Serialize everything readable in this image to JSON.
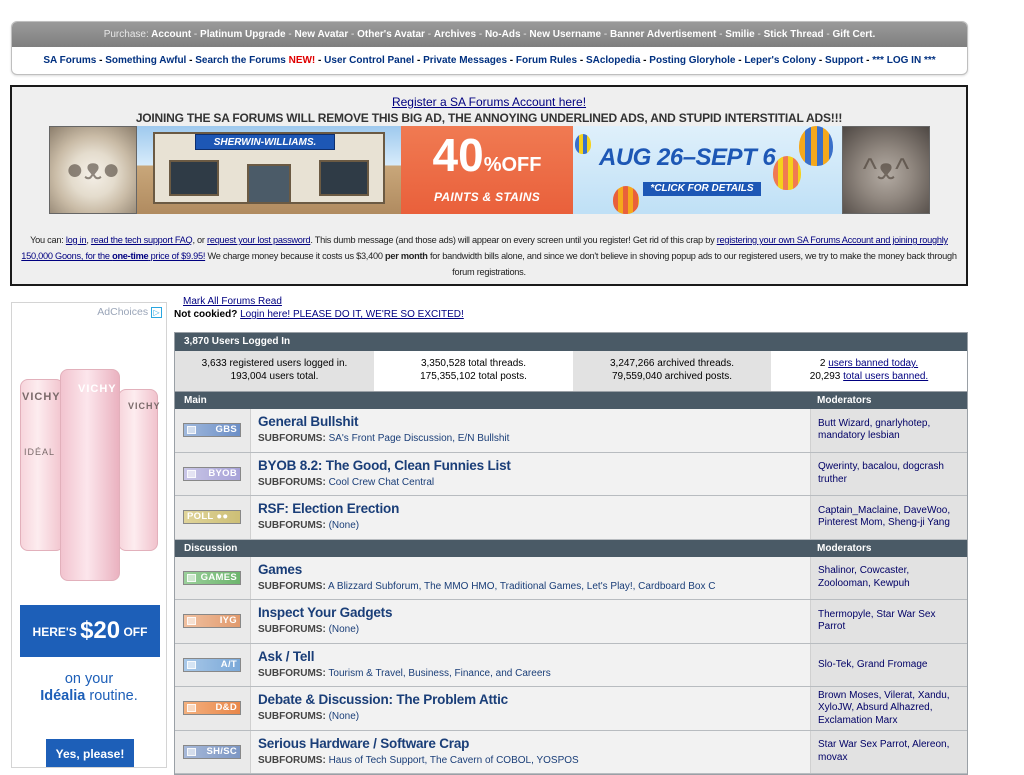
{
  "purchase": {
    "label": "Purchase:",
    "items": [
      "Account",
      "Platinum Upgrade",
      "New Avatar",
      "Other's Avatar",
      "Archives",
      "No-Ads",
      "New Username",
      "Banner Advertisement",
      "Smilie",
      "Stick Thread",
      "Gift Cert."
    ]
  },
  "nav": {
    "items": [
      "SA Forums",
      "Something Awful",
      "Search the Forums",
      "User Control Panel",
      "Private Messages",
      "Forum Rules",
      "SAclopedia",
      "Posting Gloryhole",
      "Leper's Colony",
      "Support",
      "*** LOG IN ***"
    ],
    "new_badge": "NEW!"
  },
  "ad_panel": {
    "register_link": "Register a SA Forums Account here!",
    "headline": "JOINING THE SA FORUMS WILL REMOVE THIS BIG AD, THE ANNOYING UNDERLINED ADS, AND STUPID INTERSTITIAL ADS!!!",
    "banner": {
      "store_sign": "SHERWIN-WILLIAMS.",
      "percent": "40",
      "percent_sign": "%",
      "off": "OFF",
      "offer_sub": "PAINTS & STAINS",
      "dates": "AUG 26–SEPT 6",
      "cta": "*CLICK FOR DETAILS"
    },
    "msg": {
      "p1": "You can: ",
      "login": "log in",
      "p2": ", ",
      "faq": "read the tech support FAQ",
      "p3": ", or ",
      "request_pw": "request your lost password",
      "p4": ". This dumb message (and those ads) will appear on every screen until you register! Get rid of this crap by ",
      "register_own": "registering your own SA Forums Account and joining roughly 150,000 Goons, for the ",
      "one_time": "one-time",
      "price": " price of $9.95!",
      "p5": " We charge money because it costs us $3,400 ",
      "per_month": "per month",
      "p6": " for bandwidth bills alone, and since we don't believe in shoving popup ads to our registered users, we try to make the money back through forum registrations."
    }
  },
  "side_ad": {
    "adchoices": "AdChoices",
    "brand": "VICHY",
    "product_line": "IDÉAL",
    "promo_pre": "HERE'S ",
    "promo_amount": "$20",
    "promo_post": " OFF",
    "line1": "on your",
    "line2_bold": "Idéalia",
    "line2_rest": " routine.",
    "button": "Yes, please!"
  },
  "top_links": {
    "mark_all": "Mark All Forums Read",
    "not_cookied": "Not cookied?",
    "login_here": "Login here! PLEASE DO IT, WE'RE SO EXCITED!"
  },
  "users": {
    "header": "3,870 Users Logged In",
    "registered_logged": "3,633 registered users logged in.",
    "users_total": "193,004 users total.",
    "threads_total": "3,350,528 total threads.",
    "posts_total": "175,355,102 total posts.",
    "archived_threads": "3,247,266 archived threads.",
    "archived_posts": "79,559,040 archived posts.",
    "banned_today_num": "2",
    "banned_today_link": "users banned today.",
    "banned_total_num": "20,293",
    "banned_total_link": "total users banned."
  },
  "sections": [
    {
      "name": "Main",
      "moderators_label": "Moderators",
      "forums": [
        {
          "tag": "GBS",
          "title": "General Bullshit",
          "subforums": "SA's Front Page Discussion, E/N Bullshit",
          "mods": "Butt Wizard, gnarlyhotep, mandatory lesbian"
        },
        {
          "tag": "BYOB",
          "title": "BYOB 8.2: The Good, Clean Funnies List",
          "subforums": "Cool Crew Chat Central",
          "mods": "Qwerinty, bacalou, dogcrash truther"
        },
        {
          "tag": "POLL",
          "title": "RSF: Election Erection",
          "subforums": "(None)",
          "mods": "Captain_Maclaine, DaveWoo, Pinterest Mom, Sheng-ji Yang"
        }
      ]
    },
    {
      "name": "Discussion",
      "moderators_label": "Moderators",
      "forums": [
        {
          "tag": "GAMES",
          "title": "Games",
          "subforums": "A Blizzard Subforum, The MMO HMO, Traditional Games, Let's Play!, Cardboard Box C",
          "mods": "Shalinor, Cowcaster, Zoolooman, Kewpuh"
        },
        {
          "tag": "IYG",
          "title": "Inspect Your Gadgets",
          "subforums": "(None)",
          "mods": "Thermopyle, Star War Sex Parrot"
        },
        {
          "tag": "A/T",
          "title": "Ask / Tell",
          "subforums": "Tourism & Travel, Business, Finance, and Careers",
          "mods": "Slo-Tek, Grand Fromage"
        },
        {
          "tag": "D&D",
          "title": "Debate & Discussion: The Problem Attic",
          "subforums": "(None)",
          "mods": "Brown Moses, Vilerat, Xandu, XyloJW, Absurd Alhazred, Exclamation Marx"
        },
        {
          "tag": "SH/SC",
          "title": "Serious Hardware / Software Crap",
          "subforums": "Haus of Tech Support, The Cavern of COBOL, YOSPOS",
          "mods": "Star War Sex Parrot, Alereon, movax"
        }
      ]
    }
  ],
  "subforums_label": "SUBFORUMS:"
}
